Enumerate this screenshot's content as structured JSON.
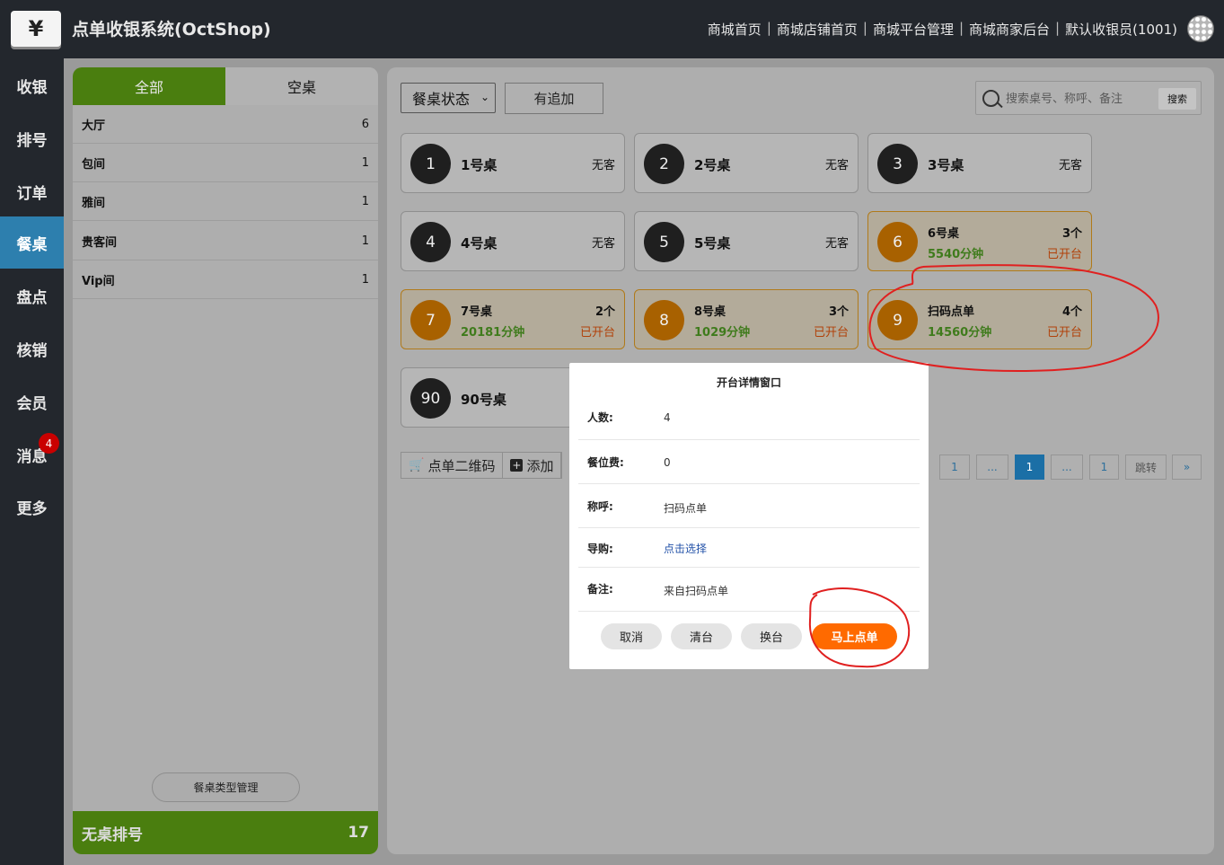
{
  "header": {
    "logo_icon": "¥",
    "title": "点单收银系统(OctShop)",
    "nav": [
      "商城首页",
      "商城店铺首页",
      "商城平台管理",
      "商城商家后台",
      "默认收银员(1001)"
    ]
  },
  "sidebar": {
    "items": [
      "收银",
      "排号",
      "订单",
      "餐桌",
      "盘点",
      "核销",
      "会员",
      "消息",
      "更多"
    ],
    "active": "餐桌",
    "message_badge": "4"
  },
  "left_panel": {
    "tabs": [
      "全部",
      "空桌"
    ],
    "categories": [
      {
        "name": "大厅",
        "count": "6"
      },
      {
        "name": "包间",
        "count": "1"
      },
      {
        "name": "雅间",
        "count": "1"
      },
      {
        "name": "贵客间",
        "count": "1"
      },
      {
        "name": "Vip间",
        "count": "1"
      }
    ],
    "type_manage_label": "餐桌类型管理",
    "queue_label": "无桌排号",
    "queue_count": "17"
  },
  "toolbar": {
    "status_select": "餐桌状态",
    "append_label": "有追加",
    "search_placeholder": "搜索桌号、称呼、备注",
    "search_label": "搜索"
  },
  "tables": [
    {
      "num": "1",
      "name": "1号桌",
      "status": "无客"
    },
    {
      "num": "2",
      "name": "2号桌",
      "status": "无客"
    },
    {
      "num": "3",
      "name": "3号桌",
      "status": "无客"
    },
    {
      "num": "4",
      "name": "4号桌",
      "status": "无客"
    },
    {
      "num": "5",
      "name": "5号桌",
      "status": "无客"
    },
    {
      "num": "6",
      "name": "6号桌",
      "guests": "3个",
      "duration": "5540分钟",
      "status": "已开台"
    },
    {
      "num": "7",
      "name": "7号桌",
      "guests": "2个",
      "duration": "20181分钟",
      "status": "已开台"
    },
    {
      "num": "8",
      "name": "8号桌",
      "guests": "3个",
      "duration": "1029分钟",
      "status": "已开台"
    },
    {
      "num": "9",
      "name": "扫码点单",
      "guests": "4个",
      "duration": "14560分钟",
      "status": "已开台"
    },
    {
      "num": "90",
      "name": "90号桌"
    }
  ],
  "bottom_tools": {
    "qr_label": "点单二维码",
    "add_label": "添加"
  },
  "pagination": [
    "1",
    "...",
    "1",
    "...",
    "1",
    "跳转",
    "»"
  ],
  "modal": {
    "title": "开台详情窗口",
    "fields": [
      {
        "label": "人数:",
        "value": "4"
      },
      {
        "label": "餐位费:",
        "value": "0"
      },
      {
        "label": "称呼:",
        "value": "扫码点单"
      },
      {
        "label": "导购:",
        "value": "点击选择"
      },
      {
        "label": "备注:",
        "value": "来自扫码点单"
      }
    ],
    "buttons": [
      "取消",
      "清台",
      "换台",
      "马上点单"
    ]
  },
  "colors": {
    "topbar": "#23272d",
    "accent_green": "#4a7e0f",
    "sidebar_active": "#2d7fae",
    "primary_orange": "#ff6a00",
    "annotation_red": "#e02020"
  }
}
